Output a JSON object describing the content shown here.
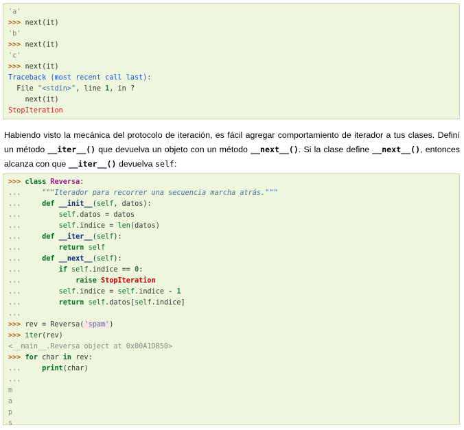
{
  "block1": {
    "lines": [
      {
        "kind": "out",
        "text": "'a'"
      },
      {
        "kind": "prompt",
        "prompt": ">>>",
        "code": "next(it)"
      },
      {
        "kind": "out",
        "text": "'b'"
      },
      {
        "kind": "prompt",
        "prompt": ">>>",
        "code": "next(it)"
      },
      {
        "kind": "out",
        "text": "'c'"
      },
      {
        "kind": "prompt",
        "prompt": ">>>",
        "code": "next(it)"
      },
      {
        "kind": "tb",
        "text": "Traceback (most recent call last):"
      },
      {
        "kind": "tbfile",
        "pre": "  File ",
        "q": "\"<stdin>\"",
        "mid": ", line ",
        "num": "1",
        "post": ", in ?"
      },
      {
        "kind": "tbcode",
        "pre": "    ",
        "code": "next(it)"
      },
      {
        "kind": "err",
        "text": "StopIteration"
      }
    ]
  },
  "paragraph": {
    "t1": "Habiendo visto la mecánica del protocolo de iteración, es fácil agregar comportamiento de iterador a tus clases. Definí un método ",
    "c1": "__iter__()",
    "t2": " que devuelva un objeto con un método ",
    "c2": "__next__()",
    "t3": ". Si la clase define ",
    "c3": "__next__()",
    "t4": ", entonces alcanza con que ",
    "c4": "__iter__()",
    "t5": " devuelva ",
    "c5": "self",
    "t6": ":"
  },
  "block2": {
    "l1": {
      "p": ">>>",
      "kw": "class",
      "name": "Reversa",
      "rest": ":"
    },
    "l2": {
      "p": "...",
      "pad": "    ",
      "doc": "\"\"\"Iterador para recorrer una secuencia marcha atrás.\"\"\""
    },
    "l3": {
      "p": "...",
      "pad": "    ",
      "kw": "def",
      "name": "__init__",
      "args": "(",
      "self": "self",
      "rest": ", datos):"
    },
    "l4": {
      "p": "...",
      "pad": "        ",
      "self": "self",
      "a": ".datos ",
      "op": "=",
      "b": " datos"
    },
    "l5": {
      "p": "...",
      "pad": "        ",
      "self": "self",
      "a": ".indice ",
      "op": "=",
      "b": " ",
      "bi": "len",
      "c": "(datos)"
    },
    "l6": {
      "p": "...",
      "pad": "    ",
      "kw": "def",
      "name": "__iter__",
      "args": "(",
      "self": "self",
      "rest": "):"
    },
    "l7": {
      "p": "...",
      "pad": "        ",
      "kw": "return",
      "self": "self"
    },
    "l8": {
      "p": "...",
      "pad": "    ",
      "kw": "def",
      "name": "__next__",
      "args": "(",
      "self": "self",
      "rest": "):"
    },
    "l9": {
      "p": "...",
      "pad": "        ",
      "kw": "if",
      "self": "self",
      "a": ".indice ",
      "op": "==",
      "num": "0",
      "rest": ":"
    },
    "l10": {
      "p": "...",
      "pad": "            ",
      "kw": "raise",
      "exc": "StopIteration"
    },
    "l11": {
      "p": "...",
      "pad": "        ",
      "self": "self",
      "a": ".indice ",
      "op": "=",
      "self2": "self",
      "b": ".indice ",
      "op2": "-",
      "num": "1"
    },
    "l12": {
      "p": "...",
      "pad": "        ",
      "kw": "return",
      "self": "self",
      "a": ".datos[",
      "self2": "self",
      "b": ".indice]"
    },
    "l13": {
      "p": "..."
    },
    "l14": {
      "p": ">>>",
      "a": "rev ",
      "op": "=",
      "b": " Reversa(",
      "str": "'spam'",
      "c": ")"
    },
    "l15": {
      "p": ">>>",
      "bi": "iter",
      "a": "(rev)"
    },
    "l16": {
      "text": "<__main__.Reversa object at 0x00A1DB50>"
    },
    "l17": {
      "p": ">>>",
      "kw": "for",
      "a": " char ",
      "kw2": "in",
      "b": " rev:"
    },
    "l18": {
      "p": "...",
      "pad": "    ",
      "kw": "print",
      "a": "(char)"
    },
    "l19": {
      "p": "..."
    },
    "outs": [
      "m",
      "a",
      "p",
      "s"
    ]
  }
}
